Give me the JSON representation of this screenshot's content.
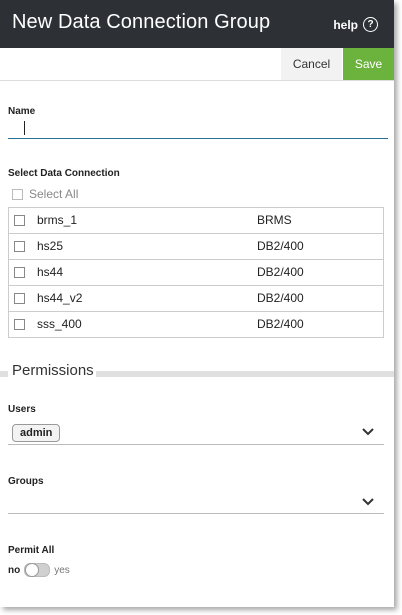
{
  "header": {
    "title": "New Data Connection Group",
    "help_label": "help",
    "help_icon": "?"
  },
  "toolbar": {
    "cancel_label": "Cancel",
    "save_label": "Save"
  },
  "name": {
    "label": "Name",
    "value": ""
  },
  "connections": {
    "label": "Select Data Connection",
    "select_all_label": "Select All",
    "rows": [
      {
        "name": "brms_1",
        "type": "BRMS"
      },
      {
        "name": "hs25",
        "type": "DB2/400"
      },
      {
        "name": "hs44",
        "type": "DB2/400"
      },
      {
        "name": "hs44_v2",
        "type": "DB2/400"
      },
      {
        "name": "sss_400",
        "type": "DB2/400"
      }
    ]
  },
  "permissions": {
    "heading": "Permissions",
    "users_label": "Users",
    "users_selected": [
      "admin"
    ],
    "groups_label": "Groups",
    "permit_all_label": "Permit All",
    "toggle_off_label": "no",
    "toggle_on_label": "yes"
  },
  "colors": {
    "header_bg": "#2d3136",
    "save_bg": "#6cb33e",
    "input_line": "#2a6f97"
  }
}
